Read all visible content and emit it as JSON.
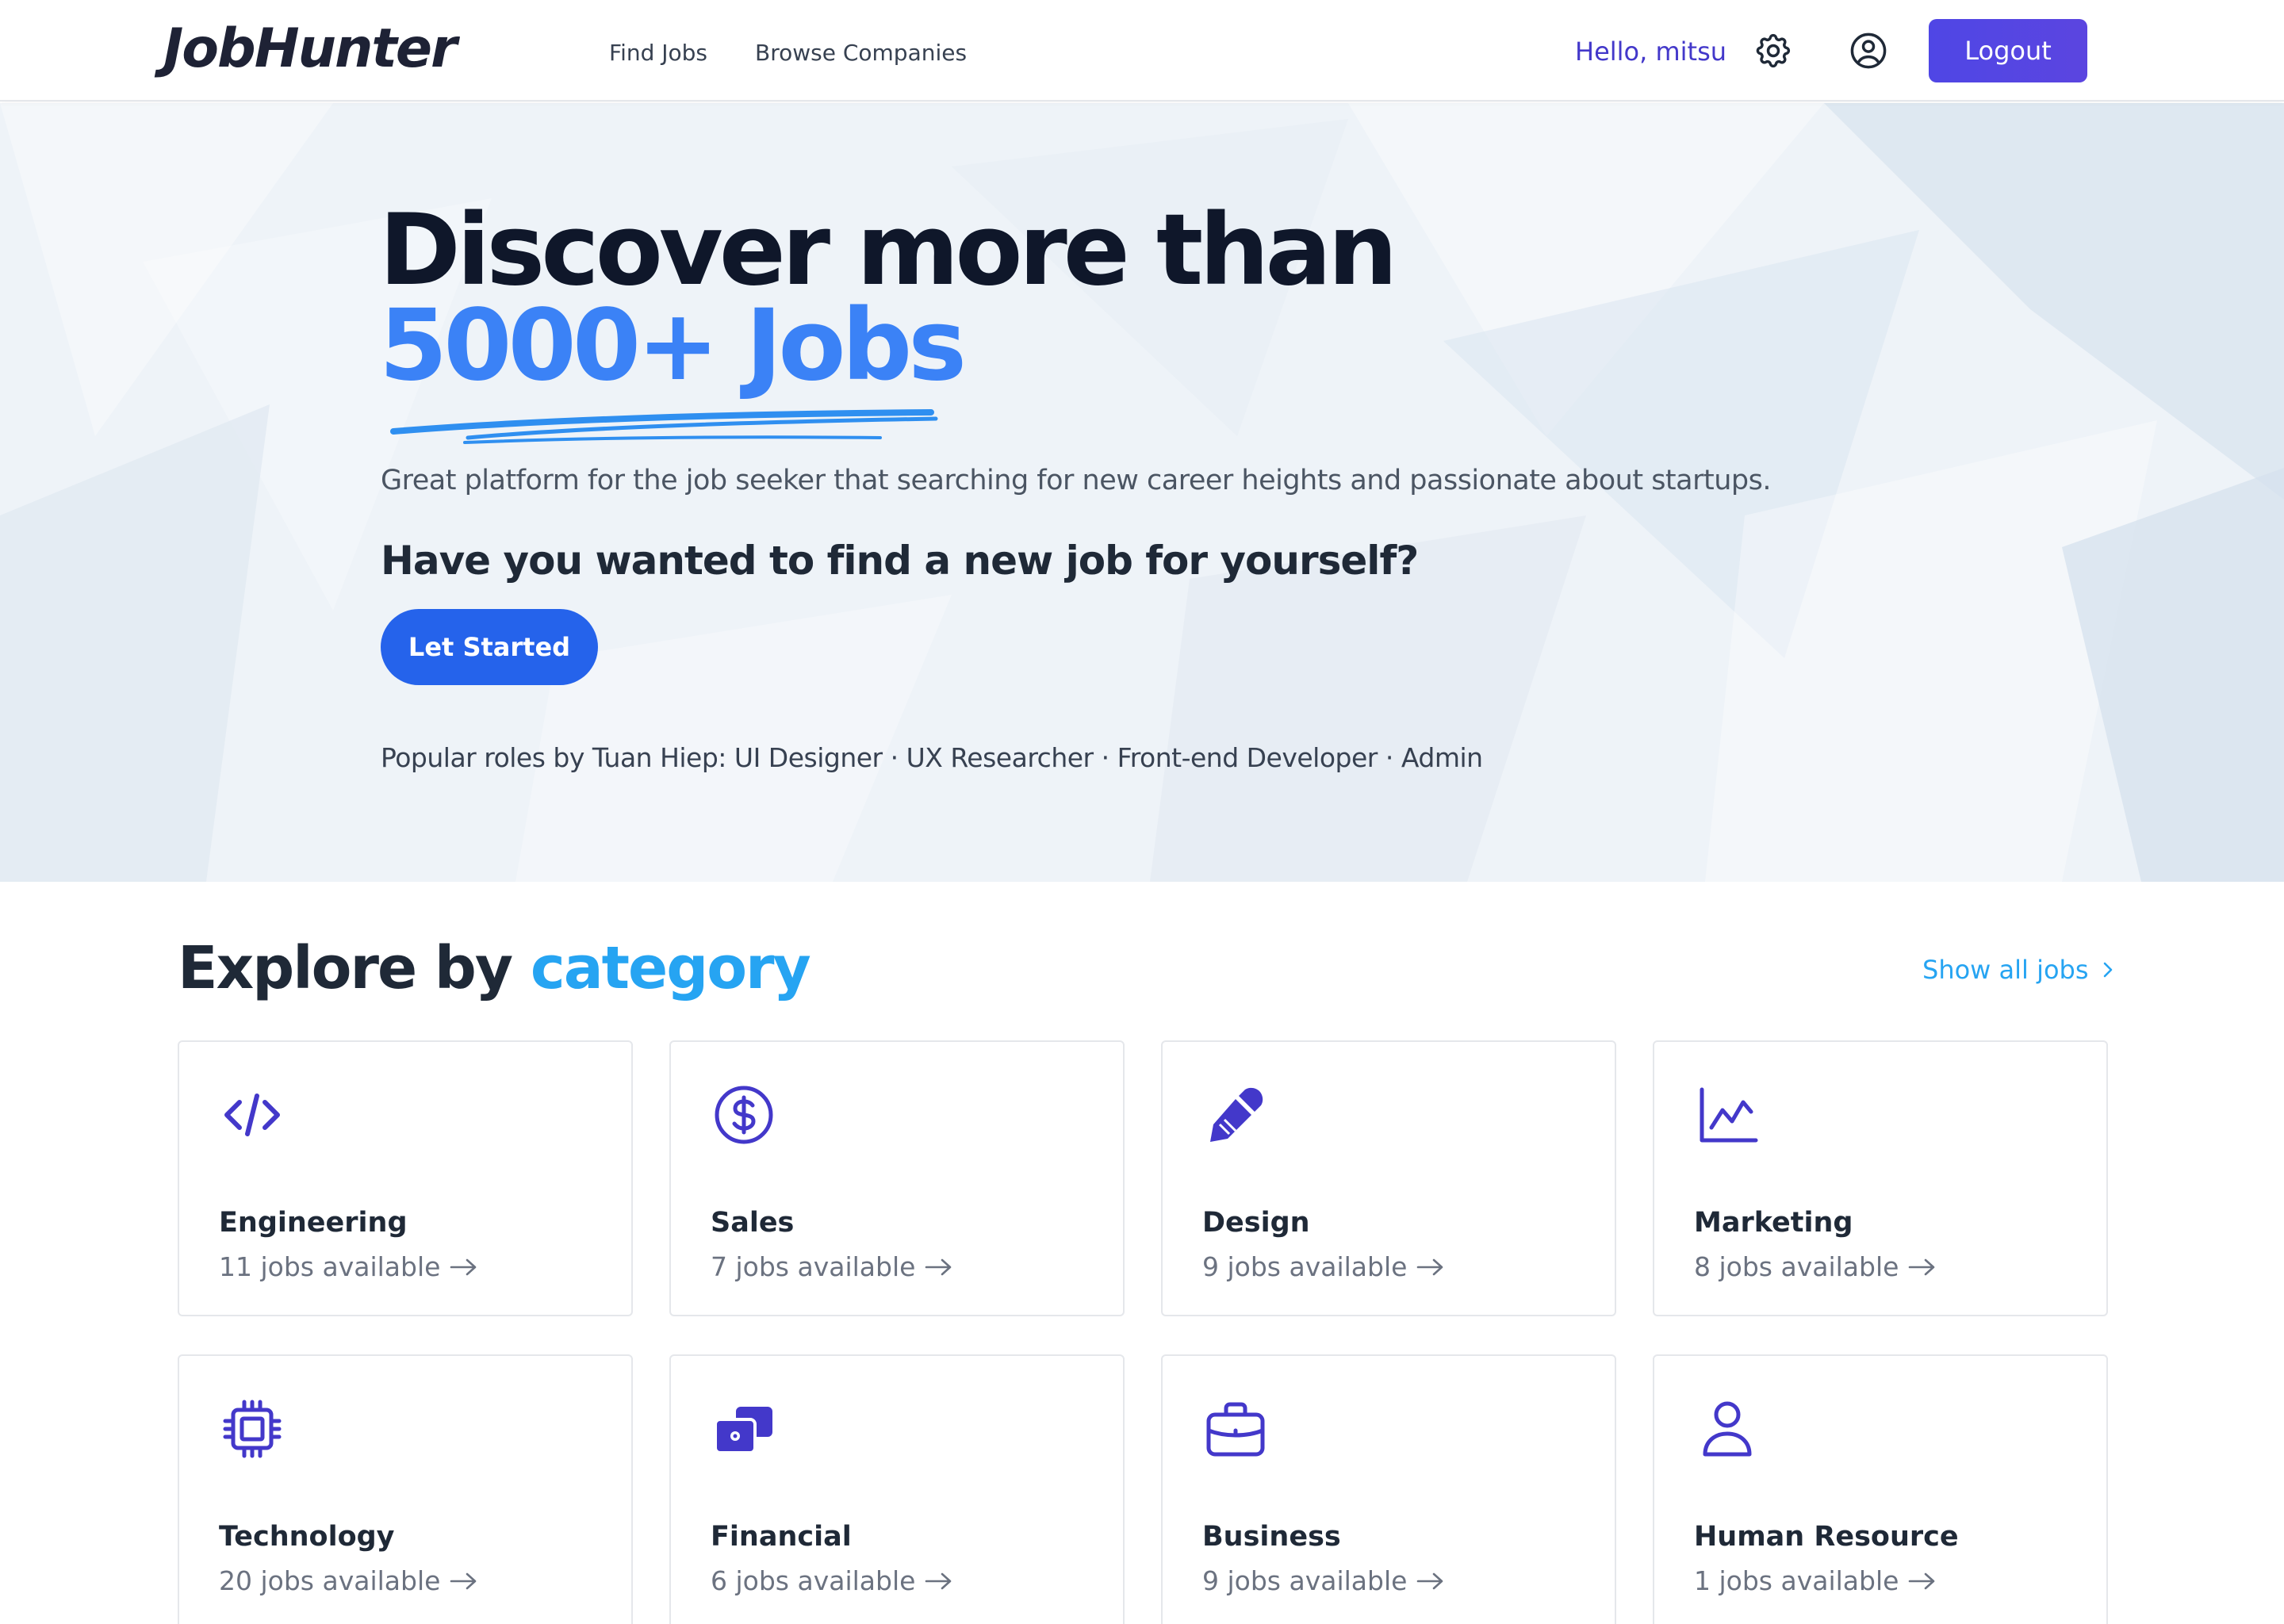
{
  "header": {
    "logo": "JobHunter",
    "nav": [
      "Find Jobs",
      "Browse Companies"
    ],
    "greeting": "Hello, mitsu",
    "logout_label": "Logout"
  },
  "hero": {
    "title_line1": "Discover more than",
    "title_line2": "5000+ Jobs",
    "subtitle": "Great platform for the job seeker that searching for new career heights and passionate about startups.",
    "question": "Have you wanted to find a new job for yourself?",
    "cta_label": "Let Started",
    "popular_prefix": "Popular roles by Tuan Hiep:",
    "popular_roles": [
      "UI Designer",
      "UX Researcher",
      "Front-end Developer",
      "Admin"
    ],
    "separator": "·"
  },
  "categories": {
    "title_prefix": "Explore by",
    "title_accent": "category",
    "show_all_label": "Show all jobs",
    "items": [
      {
        "name": "Engineering",
        "count": "11 jobs available",
        "icon": "code-icon"
      },
      {
        "name": "Sales",
        "count": "7 jobs available",
        "icon": "dollar-circle-icon"
      },
      {
        "name": "Design",
        "count": "9 jobs available",
        "icon": "pen-icon"
      },
      {
        "name": "Marketing",
        "count": "8 jobs available",
        "icon": "chart-line-icon"
      },
      {
        "name": "Technology",
        "count": "20 jobs available",
        "icon": "cpu-chip-icon"
      },
      {
        "name": "Financial",
        "count": "6 jobs available",
        "icon": "money-icon"
      },
      {
        "name": "Business",
        "count": "9 jobs available",
        "icon": "briefcase-icon"
      },
      {
        "name": "Human Resource",
        "count": "1 jobs available",
        "icon": "person-icon"
      }
    ]
  },
  "colors": {
    "brand_indigo": "#4f46e5",
    "icon_indigo": "#4338ca",
    "hero_blue": "#3b82f6",
    "accent_sky": "#26a4f2",
    "cta_blue": "#2563eb",
    "dark_text": "#0f172a"
  }
}
